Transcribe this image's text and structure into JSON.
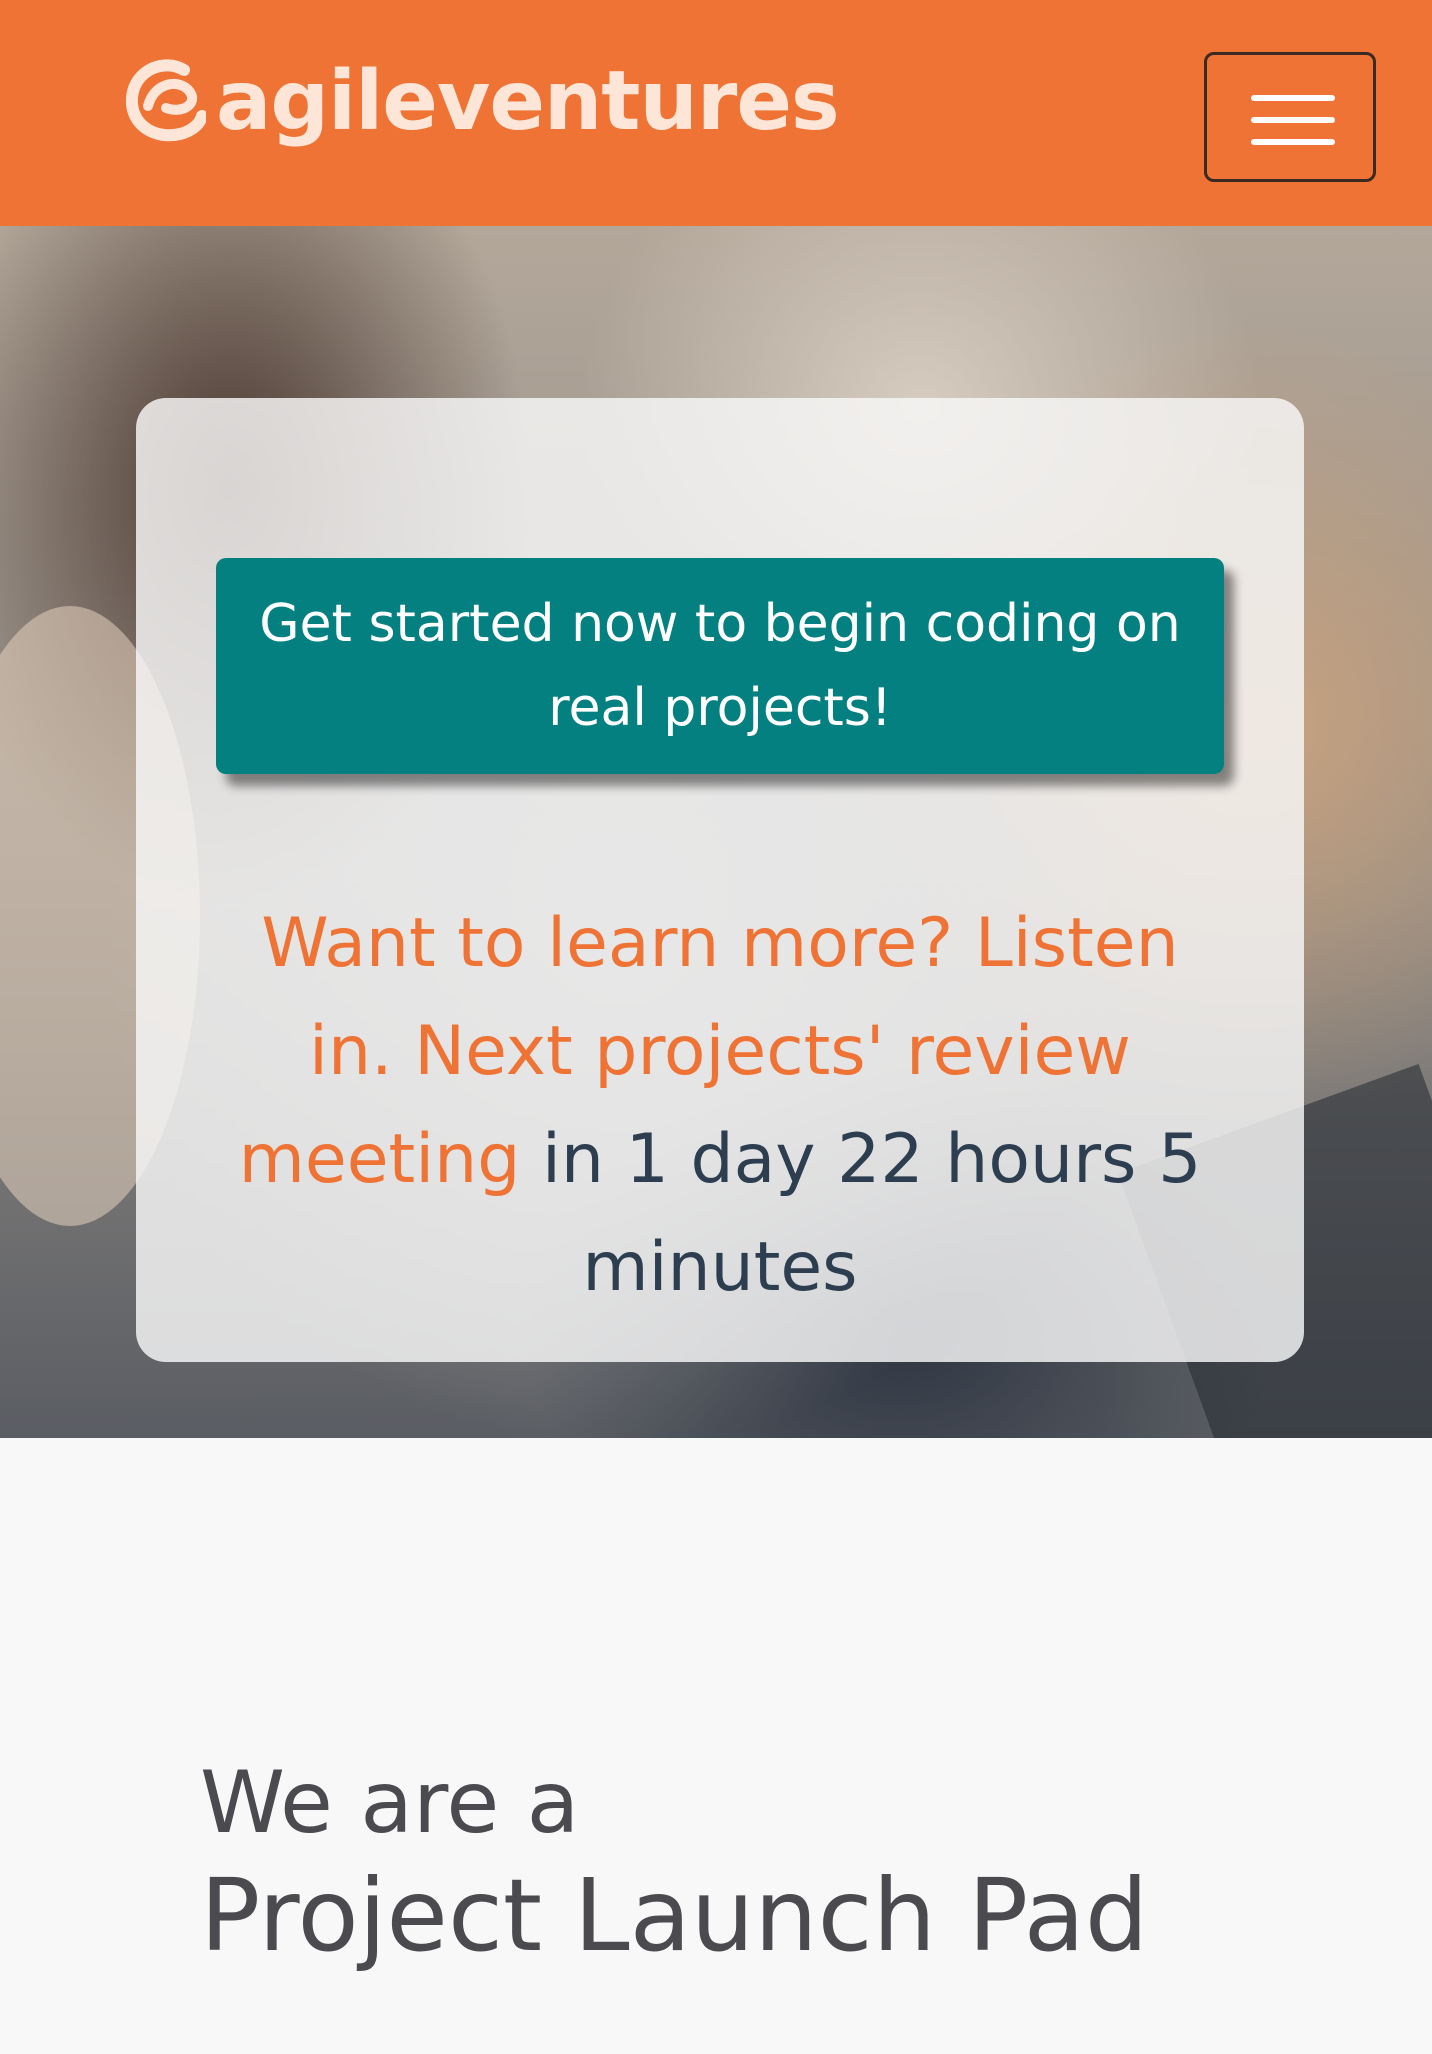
{
  "colors": {
    "brand_orange": "#ee7335",
    "cta_teal": "#058080",
    "text_dark": "#2c3e50",
    "heading_gray": "#4a4a4f",
    "page_background": "#f8f8f8"
  },
  "header": {
    "logo_icon": "agileventures-swirl-icon",
    "logo_text": "agileventures",
    "menu_icon": "hamburger-menu-icon"
  },
  "hero": {
    "background": "photo of people coding at laptops (blurred)",
    "cta_label": "Get started now to begin coding on real projects!",
    "meeting_link": "Want to learn more? Listen in. Next projects' review meeting",
    "meeting_countdown": "in 1 day 22 hours 5 minutes"
  },
  "intro": {
    "eyebrow": "We are a",
    "title": "Project Launch Pad"
  }
}
